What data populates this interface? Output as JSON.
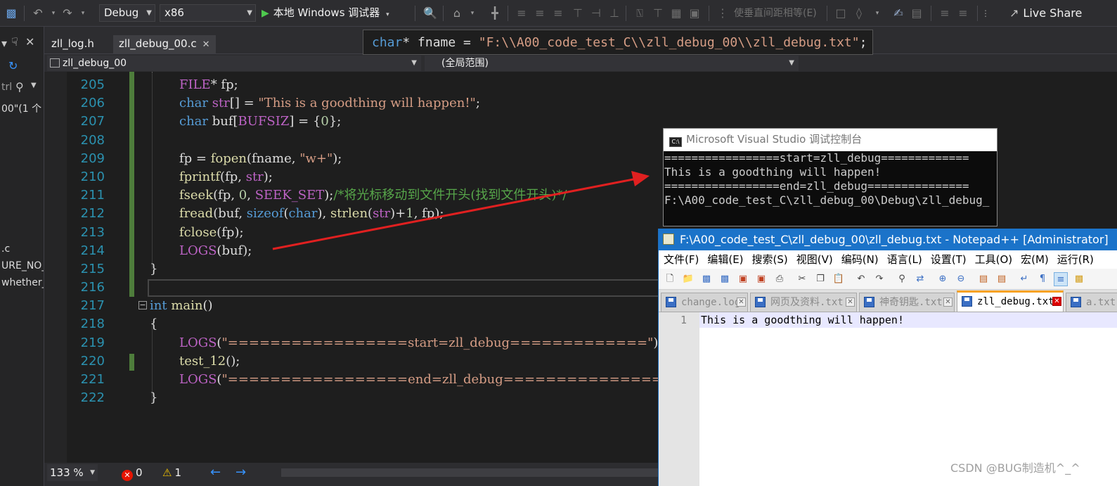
{
  "toolbar": {
    "config": "Debug",
    "platform": "x86",
    "run_label": "本地 Windows 调试器",
    "align_command": "使垂直间距相等(E)",
    "live_share": "Live Share"
  },
  "side_panel": {
    "search_label": "trl",
    "items": [
      "00\"(1 个",
      ".c",
      "URE_NO_",
      "whether_"
    ]
  },
  "tabs": [
    {
      "label": "zll_log.h"
    },
    {
      "label": "zll_debug_00.c"
    }
  ],
  "nav": {
    "project": "zll_debug_00",
    "scope": "(全局范围)"
  },
  "peek": {
    "tokens": [
      {
        "t": "char",
        "c": "kw"
      },
      {
        "t": "* fname = ",
        "c": "plain"
      },
      {
        "t": "\"F:\\\\A00_code_test_C\\\\zll_debug_00\\\\zll_debug.txt\"",
        "c": "str"
      },
      {
        "t": ";",
        "c": "plain"
      }
    ]
  },
  "code_lines": [
    {
      "num": "205",
      "tokens": [
        {
          "t": "FILE",
          "c": "mac"
        },
        {
          "t": "* fp;",
          "c": "plain"
        }
      ]
    },
    {
      "num": "206",
      "tokens": [
        {
          "t": "char",
          "c": "kw"
        },
        {
          "t": " ",
          "c": "plain"
        },
        {
          "t": "str",
          "c": "mac"
        },
        {
          "t": "[] = ",
          "c": "plain"
        },
        {
          "t": "\"This is a goodthing will happen!\"",
          "c": "str"
        },
        {
          "t": ";",
          "c": "plain"
        }
      ]
    },
    {
      "num": "207",
      "tokens": [
        {
          "t": "char",
          "c": "kw"
        },
        {
          "t": " buf[",
          "c": "plain"
        },
        {
          "t": "BUFSIZ",
          "c": "mac"
        },
        {
          "t": "] = {",
          "c": "plain"
        },
        {
          "t": "0",
          "c": "num"
        },
        {
          "t": "};",
          "c": "plain"
        }
      ]
    },
    {
      "num": "208",
      "tokens": []
    },
    {
      "num": "209",
      "tokens": [
        {
          "t": "fp = ",
          "c": "plain"
        },
        {
          "t": "fopen",
          "c": "fn"
        },
        {
          "t": "(fname, ",
          "c": "plain"
        },
        {
          "t": "\"w+\"",
          "c": "str"
        },
        {
          "t": ");",
          "c": "plain"
        }
      ]
    },
    {
      "num": "210",
      "tokens": [
        {
          "t": "fprintf",
          "c": "fn"
        },
        {
          "t": "(fp, ",
          "c": "plain"
        },
        {
          "t": "str",
          "c": "mac"
        },
        {
          "t": ");",
          "c": "plain"
        }
      ]
    },
    {
      "num": "211",
      "tokens": [
        {
          "t": "fseek",
          "c": "fn"
        },
        {
          "t": "(fp, ",
          "c": "plain"
        },
        {
          "t": "0",
          "c": "num"
        },
        {
          "t": ", ",
          "c": "plain"
        },
        {
          "t": "SEEK_SET",
          "c": "mac"
        },
        {
          "t": ");",
          "c": "plain"
        },
        {
          "t": "/*将光标移动到文件开头(找到文件开头)*/",
          "c": "cm"
        }
      ]
    },
    {
      "num": "212",
      "tokens": [
        {
          "t": "fread",
          "c": "fn"
        },
        {
          "t": "(buf, ",
          "c": "plain"
        },
        {
          "t": "sizeof",
          "c": "kw"
        },
        {
          "t": "(",
          "c": "plain"
        },
        {
          "t": "char",
          "c": "kw"
        },
        {
          "t": "), ",
          "c": "plain"
        },
        {
          "t": "strlen",
          "c": "fn"
        },
        {
          "t": "(",
          "c": "plain"
        },
        {
          "t": "str",
          "c": "mac"
        },
        {
          "t": ")+",
          "c": "plain"
        },
        {
          "t": "1",
          "c": "num"
        },
        {
          "t": ", fp);",
          "c": "plain"
        }
      ]
    },
    {
      "num": "213",
      "tokens": [
        {
          "t": "fclose",
          "c": "fn"
        },
        {
          "t": "(fp);",
          "c": "plain"
        }
      ]
    },
    {
      "num": "214",
      "tokens": [
        {
          "t": "LOGS",
          "c": "mac"
        },
        {
          "t": "(buf);",
          "c": "plain"
        }
      ]
    },
    {
      "num": "215",
      "tokens": []
    },
    {
      "num": "216",
      "tokens": []
    },
    {
      "num": "217",
      "tokens": [
        {
          "t": "int",
          "c": "kw"
        },
        {
          "t": " ",
          "c": "plain"
        },
        {
          "t": "main",
          "c": "fn"
        },
        {
          "t": "()",
          "c": "plain"
        }
      ]
    },
    {
      "num": "218",
      "tokens": []
    },
    {
      "num": "219",
      "tokens": [
        {
          "t": "LOGS",
          "c": "mac"
        },
        {
          "t": "(",
          "c": "plain"
        },
        {
          "t": "\"=================start=zll_debug=============\"",
          "c": "str"
        },
        {
          "t": ");",
          "c": "plain"
        }
      ]
    },
    {
      "num": "220",
      "tokens": [
        {
          "t": "test_12",
          "c": "fn"
        },
        {
          "t": "();",
          "c": "plain"
        }
      ]
    },
    {
      "num": "221",
      "tokens": [
        {
          "t": "LOGS",
          "c": "mac"
        },
        {
          "t": "(",
          "c": "plain"
        },
        {
          "t": "\"=================end=zll_debug===============\"",
          "c": "str"
        },
        {
          "t": ");",
          "c": "plain"
        }
      ]
    },
    {
      "num": "222",
      "tokens": []
    }
  ],
  "status": {
    "zoom": "133 %",
    "errors": "0",
    "warnings": "1"
  },
  "console": {
    "title": "Microsoft Visual Studio 调试控制台",
    "lines": [
      "=================start=zll_debug=============",
      "This is a goodthing will happen!",
      "=================end=zll_debug===============",
      "",
      "F:\\A00_code_test_C\\zll_debug_00\\Debug\\zll_debug_"
    ]
  },
  "notepad": {
    "title": "F:\\A00_code_test_C\\zll_debug_00\\zll_debug.txt - Notepad++ [Administrator]",
    "menu": [
      "文件(F)",
      "编辑(E)",
      "搜索(S)",
      "视图(V)",
      "编码(N)",
      "语言(L)",
      "设置(T)",
      "工具(O)",
      "宏(M)",
      "运行(R)"
    ],
    "tabs": [
      {
        "label": "change.log"
      },
      {
        "label": "网页及资料.txt"
      },
      {
        "label": "神奇钥匙.txt"
      },
      {
        "label": "zll_debug.txt"
      },
      {
        "label": "a.txt"
      }
    ],
    "line_number": "1",
    "content": "This is a goodthing will happen!"
  },
  "watermark": "CSDN @BUG制造机^_^",
  "colors": {
    "vs_bg": "#1e1e1e",
    "npp_title": "#1b73c9",
    "arrow": "#e02020"
  }
}
